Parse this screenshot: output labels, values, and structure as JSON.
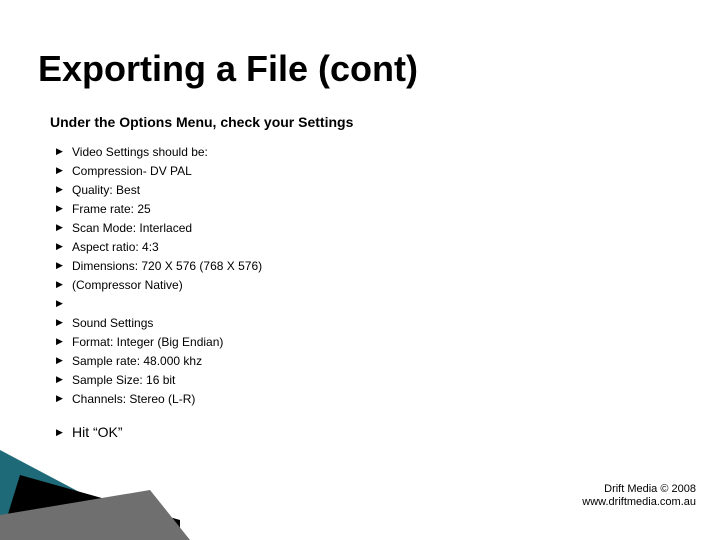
{
  "title": "Exporting a File (cont)",
  "subtitle": "Under the Options Menu, check your Settings",
  "bullets": {
    "b0": "Video Settings should be:",
    "b1": "Compression- DV PAL",
    "b2": "Quality: Best",
    "b3": "Frame rate: 25",
    "b4": "Scan Mode: Interlaced",
    "b5": "Aspect ratio: 4:3",
    "b6": "Dimensions: 720 X 576 (768 X 576)",
    "b7": "(Compressor Native)",
    "b8": "",
    "b9": "Sound Settings",
    "b10": "Format:  Integer (Big Endian)",
    "b11": "Sample rate: 48.000 khz",
    "b12": "Sample Size: 16 bit",
    "b13": "Channels: Stereo (L-R)",
    "final": "Hit “OK”"
  },
  "footer": {
    "line1": "Drift Media © 2008",
    "line2": "www.driftmedia.com.au"
  },
  "colors": {
    "tri_dark": "#000000",
    "tri_grey": "#6f6f6f",
    "tri_teal": "#1e6a78"
  }
}
